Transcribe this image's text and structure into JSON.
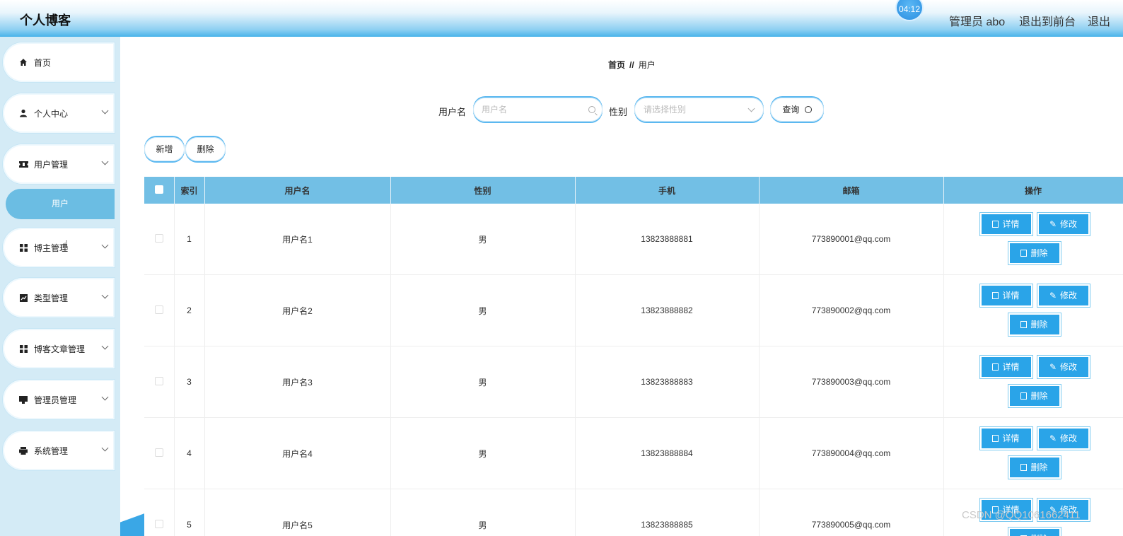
{
  "header": {
    "title": "个人博客",
    "clock": "04:12",
    "user": "管理员 abo",
    "to_front": "退出到前台",
    "logout": "退出"
  },
  "sidebar": {
    "items": [
      {
        "label": "首页",
        "icon": "home-icon"
      },
      {
        "label": "个人中心",
        "icon": "user-icon"
      },
      {
        "label": "用户管理",
        "icon": "ticket-icon"
      },
      {
        "label": "博主管理",
        "icon": "grid-icon"
      },
      {
        "label": "类型管理",
        "icon": "chart-icon"
      },
      {
        "label": "博客文章管理",
        "icon": "grid-icon"
      },
      {
        "label": "管理员管理",
        "icon": "monitor-icon"
      },
      {
        "label": "系统管理",
        "icon": "printer-icon"
      }
    ],
    "active_sub": "用户"
  },
  "breadcrumb": {
    "home": "首页",
    "sep": "//",
    "current": "用户"
  },
  "search": {
    "username_label": "用户名",
    "username_placeholder": "用户名",
    "gender_label": "性别",
    "gender_placeholder": "请选择性别",
    "query_button": "查询"
  },
  "actions": {
    "add": "新增",
    "delete": "删除"
  },
  "table": {
    "columns": [
      "索引",
      "用户名",
      "性别",
      "手机",
      "邮箱",
      "操作"
    ],
    "rows": [
      {
        "index": "1",
        "username": "用户名1",
        "gender": "男",
        "phone": "13823888881",
        "email": "773890001@qq.com"
      },
      {
        "index": "2",
        "username": "用户名2",
        "gender": "男",
        "phone": "13823888882",
        "email": "773890002@qq.com"
      },
      {
        "index": "3",
        "username": "用户名3",
        "gender": "男",
        "phone": "13823888883",
        "email": "773890003@qq.com"
      },
      {
        "index": "4",
        "username": "用户名4",
        "gender": "男",
        "phone": "13823888884",
        "email": "773890004@qq.com"
      },
      {
        "index": "5",
        "username": "用户名5",
        "gender": "男",
        "phone": "13823888885",
        "email": "773890005@qq.com"
      }
    ],
    "op_labels": {
      "detail": "详情",
      "edit": "修改",
      "delete": "删除"
    }
  },
  "watermark": "CSDN @QQ1061662411",
  "colors": {
    "accent": "#2aa4e8",
    "header_blue": "#48b3ea",
    "table_header": "#72bfe5",
    "sidebar_bg": "#d4ebf6"
  }
}
